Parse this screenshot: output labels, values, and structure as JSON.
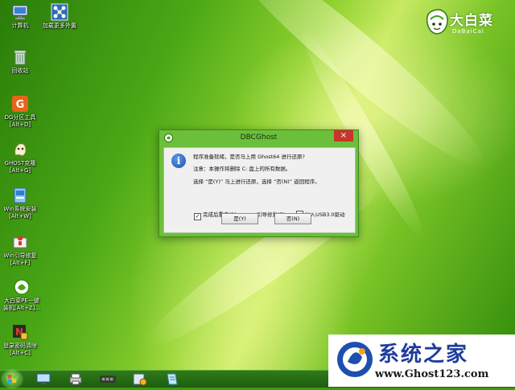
{
  "desktop": {
    "icons": [
      {
        "label": "计算机",
        "icon": "computer-icon"
      },
      {
        "label": "加载更多外置",
        "icon": "network-load-icon"
      },
      {
        "label": "回收站",
        "icon": "recycle-bin-icon"
      },
      {
        "label": "DG分区工具\n[Alt+D]",
        "icon": "partition-tool-icon"
      },
      {
        "label": "GHOST克隆\n[Alt+G]",
        "icon": "ghost-icon"
      },
      {
        "label": "Win系统安装\n[Alt+W]",
        "icon": "windows-install-icon"
      },
      {
        "label": "Win引导修复\n[Alt+F]",
        "icon": "boot-repair-icon"
      },
      {
        "label": "大白菜PE一键\n装机[Alt+Z]...",
        "icon": "dabaicai-install-icon"
      },
      {
        "label": "登录密码清除\n[Alt+C]",
        "icon": "password-clear-icon"
      }
    ]
  },
  "brand": {
    "name": "大白菜",
    "sub": "DaBaiCai"
  },
  "dialog": {
    "title": "DBCGhost",
    "close": "×",
    "line1": "程序准备就绪，是否马上用 Ghost64 进行还原?",
    "line2": "注意：本操作将删除 C: 盘上的所有数据。",
    "line3": "选择 “是(Y)” 马上进行还原，选择 “否(N)” 返回程序。",
    "checkboxes": [
      {
        "label": "完成后重启(R)",
        "checked": true
      },
      {
        "label": "引导修复(F)",
        "checked": true
      },
      {
        "label": "注入USB3.0驱动",
        "checked": false
      }
    ],
    "yes_button": "是(Y)",
    "no_button": "否(N)"
  },
  "taskbar": {
    "apps": [
      "start-orb",
      "monitor-icon",
      "printer-icon",
      "memory-chip-icon",
      "network-settings-icon",
      "notepad-icon"
    ]
  },
  "watermark": {
    "title": "系统之家",
    "url": "www.Ghost123.com"
  },
  "colors": {
    "dialog_frame": "#6bbf3a",
    "close_button": "#c7352c",
    "watermark_title": "#1e3c9c"
  }
}
